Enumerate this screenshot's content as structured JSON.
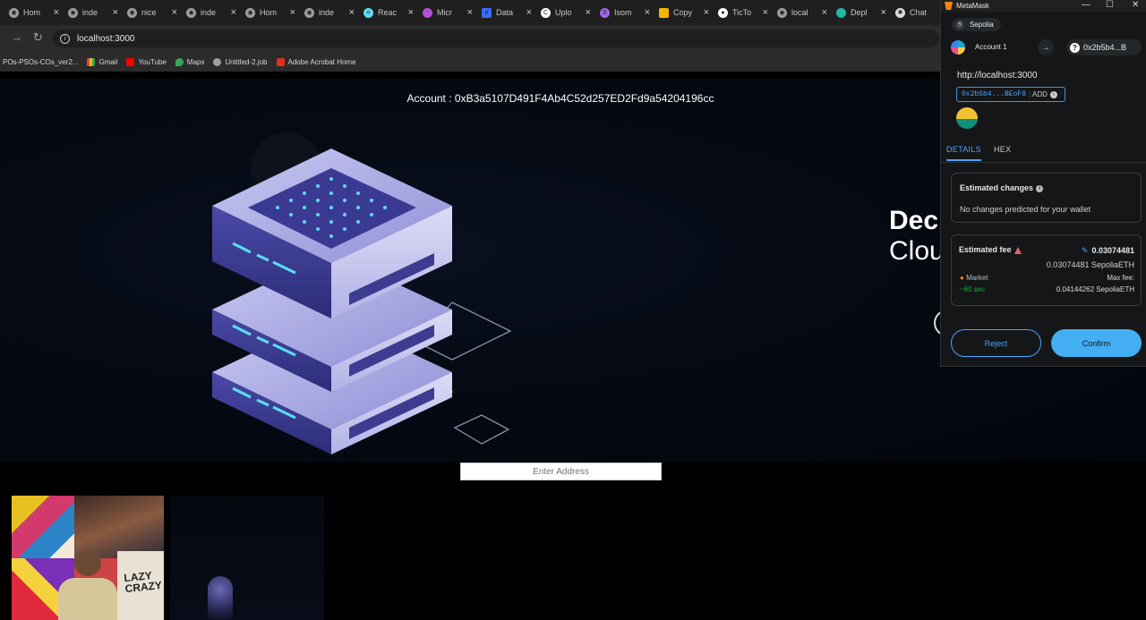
{
  "browser": {
    "tabs": [
      {
        "label": "Hom",
        "icon": "globe-icon"
      },
      {
        "label": "inde",
        "icon": "globe-icon"
      },
      {
        "label": "nice",
        "icon": "globe-icon"
      },
      {
        "label": "inde",
        "icon": "globe-icon"
      },
      {
        "label": "Hom",
        "icon": "globe-icon"
      },
      {
        "label": "inde",
        "icon": "globe-icon"
      },
      {
        "label": "Reac",
        "icon": "react-icon"
      },
      {
        "label": "Micr",
        "icon": "micro-icon"
      },
      {
        "label": "Data",
        "icon": "notion-icon"
      },
      {
        "label": "Uplo",
        "icon": "upload-icon"
      },
      {
        "label": "Isom",
        "icon": "isometric-icon"
      },
      {
        "label": "Copy",
        "icon": "slides-icon"
      },
      {
        "label": "TicTo",
        "icon": "github-icon"
      },
      {
        "label": "local",
        "icon": "globe-icon"
      },
      {
        "label": "Depl",
        "icon": "deploy-icon"
      },
      {
        "label": "Chat",
        "icon": "chatgpt-icon"
      }
    ],
    "url": "localhost:3000",
    "bookmarks": [
      {
        "label": "POs-PSOs-COs_ver2...",
        "icon": "none"
      },
      {
        "label": "Gmail",
        "icon": "gmail-icon"
      },
      {
        "label": "YouTube",
        "icon": "youtube-icon"
      },
      {
        "label": "Maps",
        "icon": "maps-icon"
      },
      {
        "label": "Untitled-2.job",
        "icon": "globe-icon"
      },
      {
        "label": "Adobe Acrobat Home",
        "icon": "acrobat-icon"
      }
    ]
  },
  "page": {
    "account_text": "Account : 0xB3a5107D491F4Ab4C52d257ED2Fd9a54204196cc",
    "hero_title_line1": "Dec",
    "hero_title_line2": "Clou",
    "address_placeholder": "Enter Address",
    "card1_text_a": "LAZY",
    "card1_text_b": "CRAZY"
  },
  "metamask": {
    "window_title": "MetaMask",
    "network": "Sepolia",
    "network_initial": "S",
    "account_name": "Account 1",
    "to_address": "0x2b5b4...B",
    "origin": "http://localhost:3000",
    "contract_address": "0x2b5b4...BEoF8",
    "contract_add_label": ": ADD",
    "tabs": {
      "details": "DETAILS",
      "hex": "HEX"
    },
    "estimated_changes": {
      "title": "Estimated changes",
      "text": "No changes predicted for your wallet"
    },
    "estimated_fee": {
      "title": "Estimated fee",
      "amount": "0.03074481",
      "amount_full": "0.03074481 SepoliaETH",
      "market_label": "Market",
      "time": "~60 sec",
      "max_fee_label": "Max fee:",
      "max_fee_value": "0.04144262 SepoliaETH"
    },
    "buttons": {
      "reject": "Reject",
      "confirm": "Confirm"
    }
  },
  "colors": {
    "accent": "#4da3ff",
    "confirm": "#43aef2",
    "warning": "#e06470",
    "time_green": "#28a745"
  }
}
